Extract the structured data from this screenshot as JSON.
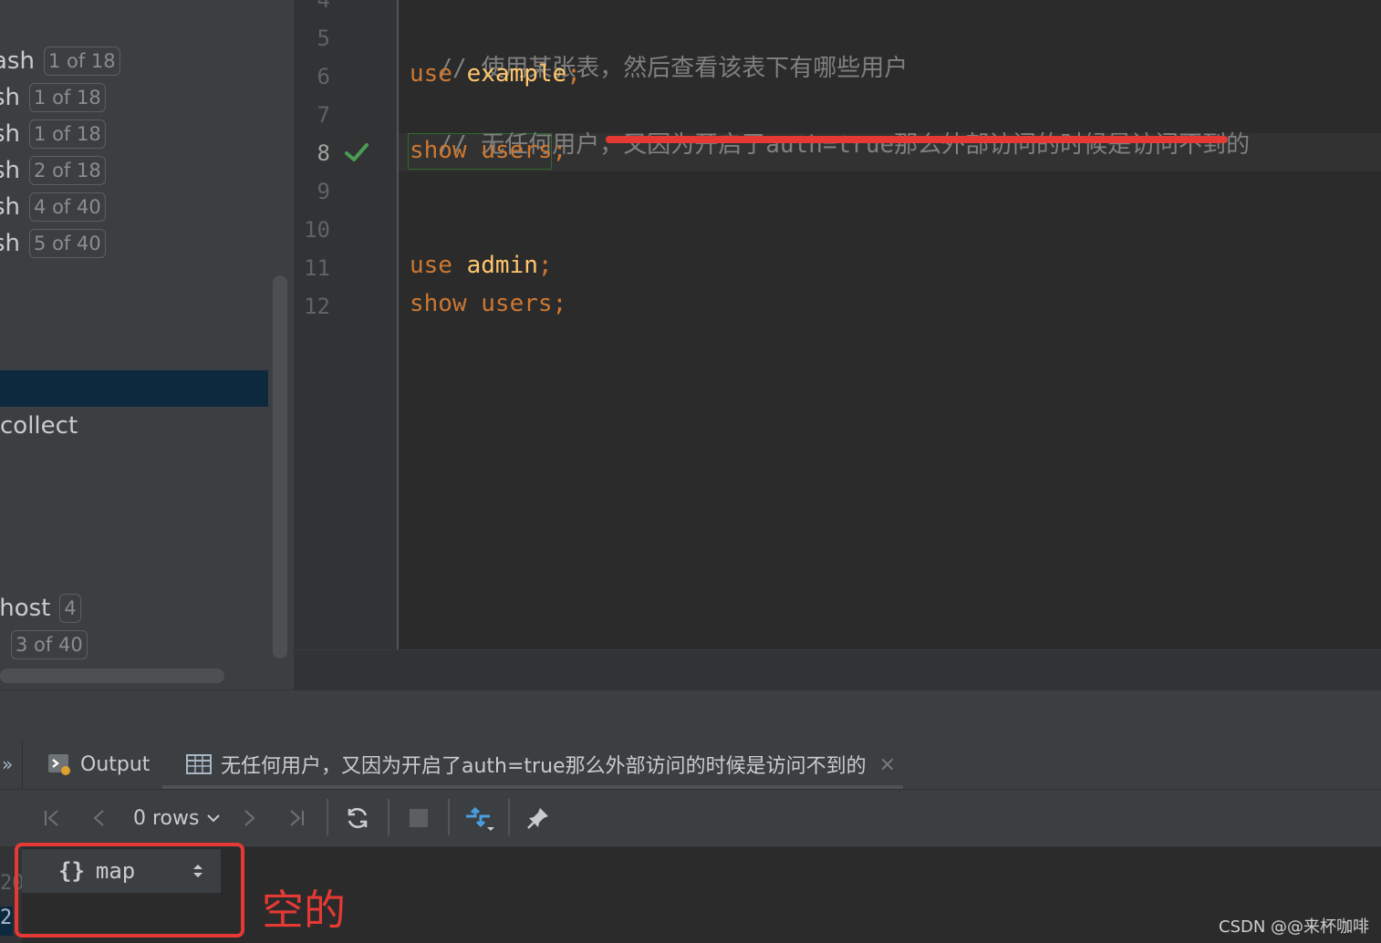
{
  "sidebar": {
    "items": [
      {
        "text": "ash",
        "badge": "1 of 18"
      },
      {
        "text": "sh",
        "badge": "1 of 18"
      },
      {
        "text": "sh",
        "badge": "1 of 18"
      },
      {
        "text": "sh",
        "badge": "2 of 18"
      },
      {
        "text": "sh",
        "badge": "4 of 40"
      },
      {
        "text": "sh",
        "badge": "5 of 40"
      }
    ],
    "collect": "collect",
    "localhost": {
      "text": "lhost",
      "badge": "4"
    },
    "last_badge": "3 of 40"
  },
  "editor": {
    "lines": [
      {
        "num": "4"
      },
      {
        "num": "5",
        "comment": "// 使用某张表，然后查看该表下有哪些用户"
      },
      {
        "num": "6",
        "kw": "use",
        "ident": "example",
        "semi": ";"
      },
      {
        "num": "7",
        "comment": "// 无任何用户，又因为开启了auth=true那么外部访问的时候是访问不到的"
      },
      {
        "num": "8",
        "kw": "show",
        "ident": "users",
        "semi": ";"
      },
      {
        "num": "9"
      },
      {
        "num": "10"
      },
      {
        "num": "11",
        "kw": "use",
        "ident": "admin",
        "semi": ";"
      },
      {
        "num": "12",
        "kw": "show",
        "ident": "users",
        "semi": ";"
      }
    ]
  },
  "tabs": {
    "overflow": "»",
    "output": "Output",
    "result": "无任何用户，又因为开启了auth=true那么外部访问的时候是访问不到的",
    "close": "×"
  },
  "toolbar": {
    "rows": "0 rows"
  },
  "results": {
    "row_nums": [
      "20",
      "2"
    ],
    "column_brace": "{}",
    "column": "map"
  },
  "annotation": {
    "empty": "空的"
  },
  "watermark": "CSDN @@来杯咖啡",
  "colors": {
    "keyword": "#cc7832",
    "identifier": "#ffc66d",
    "comment": "#808080",
    "annotation_red": "#e53935",
    "check_green": "#499c54"
  }
}
